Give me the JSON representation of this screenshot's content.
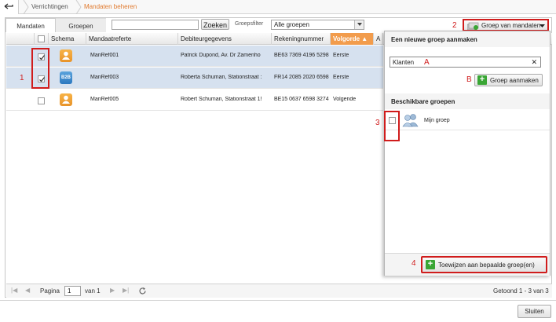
{
  "breadcrumb": {
    "items": [
      "Verrichtingen",
      "Mandaten beheren"
    ]
  },
  "tabs": [
    "Mandaten",
    "Groepen"
  ],
  "toolbar": {
    "search_value": "",
    "search_button": "Zoeken",
    "filter_label": "Groepsfilter",
    "filter_value": "Alle groepen",
    "group_menu_button": "Groep van mandaten"
  },
  "table": {
    "columns": [
      "Schema",
      "Mandaatreferte",
      "Debiteurgegevens",
      "Rekeningnummer",
      "Volgorde ▲",
      "A"
    ],
    "rows": [
      {
        "schema": "person-icon",
        "ref": "ManRef001",
        "debtor": "Patrick Dupond, Av. Dr Zamenho",
        "account": "BE63 7369 4196 5298",
        "sequence": "Eerste",
        "checked": true
      },
      {
        "schema": "B2B",
        "ref": "ManRef003",
        "debtor": "Roberta Schuman, Stationstraat :",
        "account": "FR14 2085 2020 6598",
        "sequence": "Eerste",
        "checked": true
      },
      {
        "schema": "person-icon",
        "ref": "ManRef005",
        "debtor": "Robert Schuman, Stationstraat 1!",
        "account": "BE15 0637 6598 3274",
        "sequence": "Volgende",
        "checked": false
      }
    ]
  },
  "pager": {
    "page_label": "Pagina",
    "page_value": "1",
    "of_label": "van 1",
    "status": "Getoond 1 - 3 van 3"
  },
  "group_panel": {
    "new_group_title": "Een nieuwe groep aanmaken",
    "new_group_value": "Klanten",
    "create_button": "Groep aanmaken",
    "available_title": "Beschikbare groepen",
    "groups": [
      {
        "name": "Mijn groep",
        "checked": false
      }
    ],
    "assign_button": "Toewijzen aan bepaalde groep(en)"
  },
  "annotations": {
    "n1": "1",
    "n2": "2",
    "n3": "3",
    "n4": "4",
    "A": "A",
    "B": "B"
  },
  "close_button": "Sluiten",
  "colors": {
    "accent": "#e07a2e",
    "annotation_red": "#d01c1c",
    "selected_row": "#d6e1ef",
    "sort_header": "#f29c4c",
    "add_green": "#3aa635"
  }
}
